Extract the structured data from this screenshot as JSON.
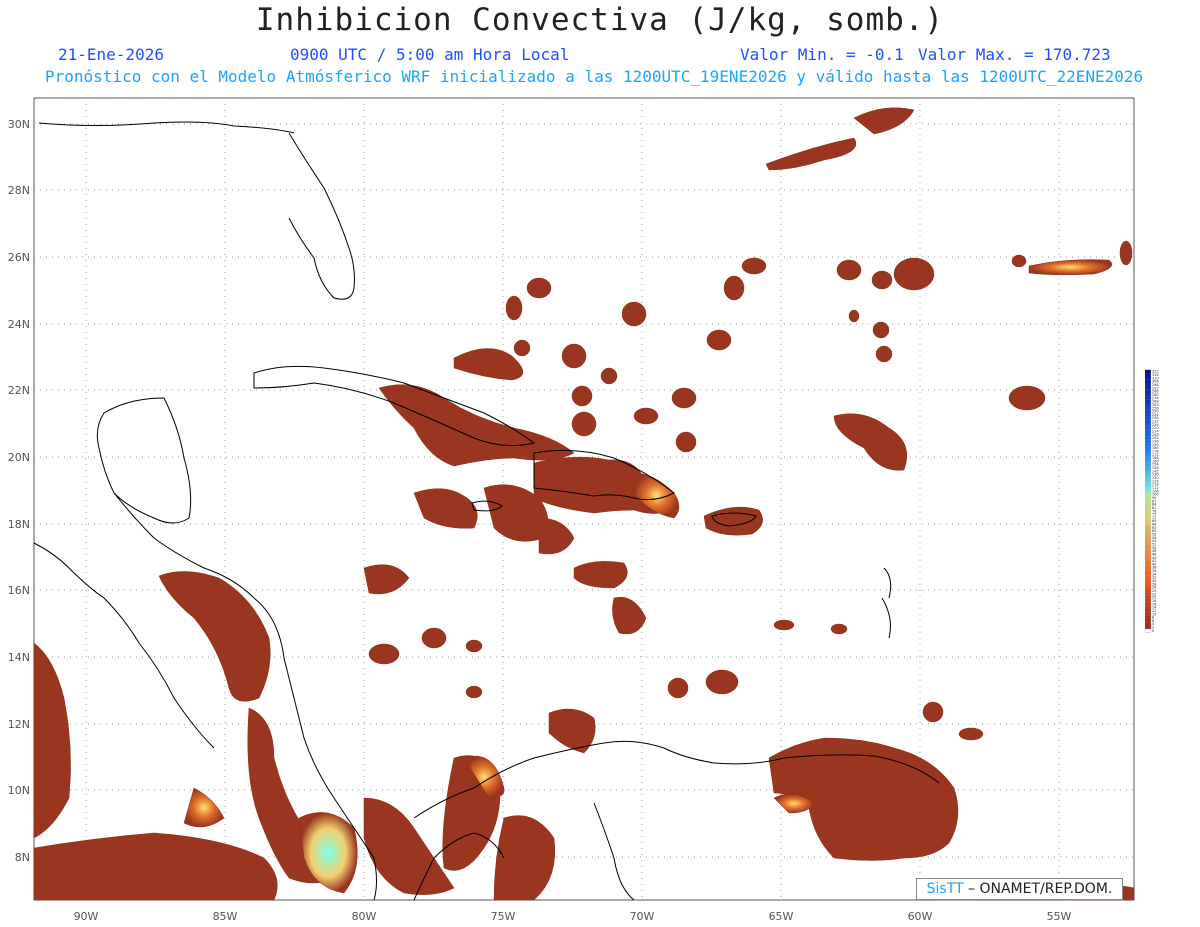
{
  "header": {
    "title": "Inhibicion Convectiva (J/kg, somb.)",
    "date": "21-Ene-2026",
    "time": "0900 UTC / 5:00 am Hora Local",
    "vmin": "Valor Min. = -0.1",
    "vmax": "Valor Max. = 170.723",
    "subtitle": "Pronóstico con el Modelo Atmósferico WRF inicializado a las 1200UTC_19ENE2026 y válido hasta las  1200UTC_22ENE2026"
  },
  "credit": {
    "brand": "SisTT",
    "org": " – ONAMET/REP.DOM."
  },
  "axes": {
    "lon_ticks": [
      "90W",
      "85W",
      "80W",
      "75W",
      "70W",
      "65W",
      "60W",
      "55W"
    ],
    "lat_ticks": [
      "30N",
      "28N",
      "26N",
      "24N",
      "22N",
      "20N",
      "18N",
      "16N",
      "14N",
      "12N",
      "10N",
      "8N"
    ]
  },
  "legend": {
    "labels": [
      "322",
      "316",
      "310",
      "304",
      "298",
      "292",
      "286",
      "280",
      "274",
      "268",
      "262",
      "256",
      "250",
      "244",
      "238",
      "232",
      "226",
      "220",
      "214",
      "208",
      "202",
      "196",
      "190",
      "184",
      "178",
      "172",
      "166",
      "160",
      "154",
      "148",
      "142",
      "136",
      "130",
      "124",
      "118",
      "112",
      "106",
      "100",
      "90",
      "87",
      "84",
      "81",
      "78",
      "75",
      "72",
      "69",
      "66",
      "63",
      "60",
      "58",
      "56",
      "54",
      "52",
      "50",
      "48",
      "46",
      "44",
      "42",
      "40",
      "38",
      "36",
      "34",
      "32",
      "30",
      "28",
      "26",
      "24",
      "22",
      "20",
      "18",
      "16",
      "14",
      "12",
      "10",
      "8",
      "6",
      "4",
      "2",
      "0"
    ]
  },
  "colors": {
    "field": "#9a3520",
    "hot": "#d9621e",
    "cyan": "#7fffe6",
    "coast": "#000000",
    "grid": "#9a9a9a"
  }
}
